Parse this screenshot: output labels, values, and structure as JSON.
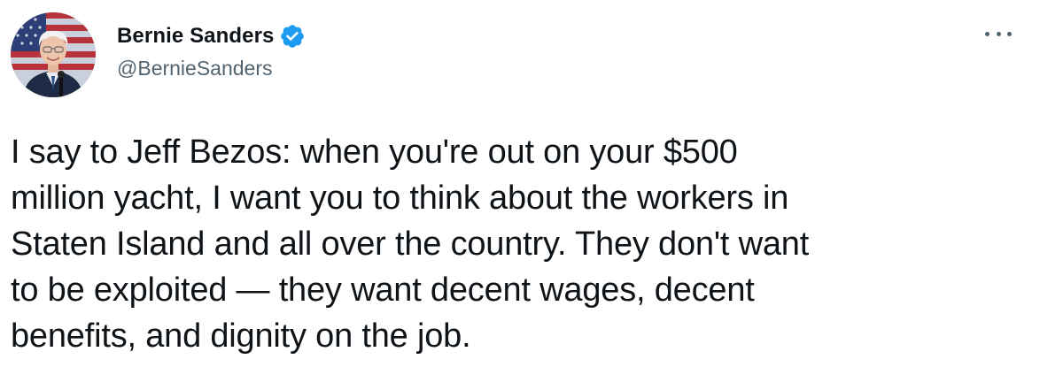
{
  "author": {
    "display_name": "Bernie Sanders",
    "handle": "@BernieSanders",
    "verified": true
  },
  "icons": {
    "verified": "verified-badge-icon",
    "more": "more-options-icon"
  },
  "tweet": {
    "lines": [
      "I say to Jeff Bezos: when you're out on your $500",
      "million yacht, I want you to think about the workers in",
      "Staten Island and all over the country. They don't want",
      "to be exploited — they want decent wages, decent",
      "benefits, and dignity on the job."
    ]
  },
  "colors": {
    "verified_blue": "#1d9bf0",
    "text_primary": "#0f1419",
    "text_secondary": "#536471"
  }
}
